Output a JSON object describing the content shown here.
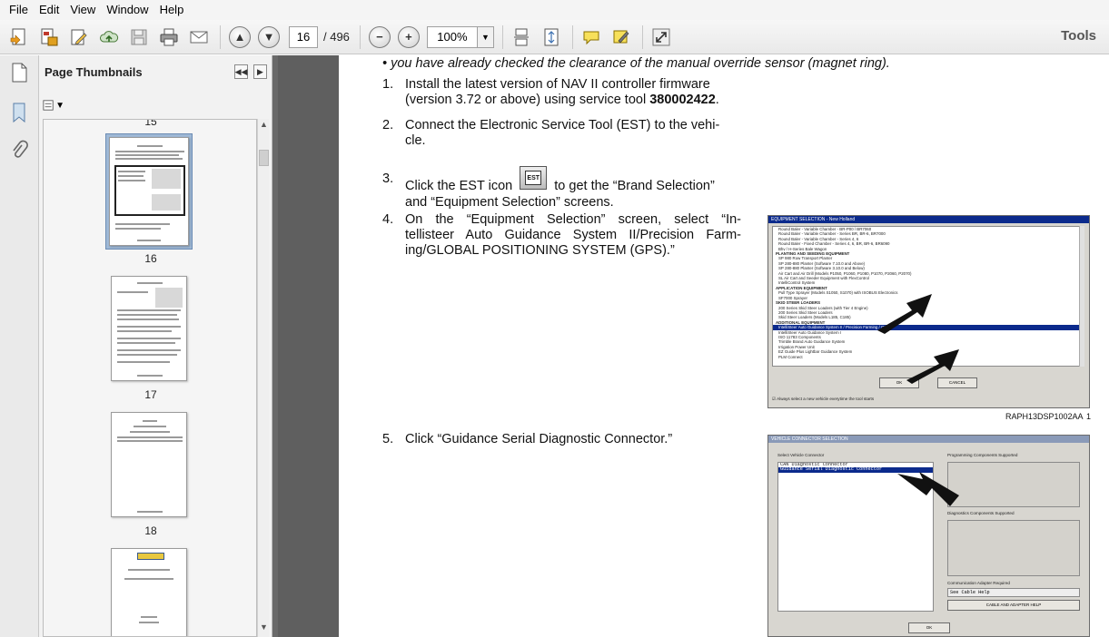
{
  "menu": [
    "File",
    "Edit",
    "View",
    "Window",
    "Help"
  ],
  "toolbar": {
    "page_current": "16",
    "page_total": "/ 496",
    "zoom": "100%",
    "tools_label": "Tools"
  },
  "thumbnails": {
    "title": "Page Thumbnails",
    "top_cut_label": "15",
    "pages": [
      {
        "num": "16",
        "selected": true
      },
      {
        "num": "17",
        "selected": false
      },
      {
        "num": "18",
        "selected": false
      }
    ]
  },
  "document": {
    "intro_line": "• you have already checked the clearance of the manual override sensor (magnet ring).",
    "steps": [
      {
        "n": "1.",
        "lines": [
          "Install the latest version of NAV II controller firmware",
          "(version 3.72 or above) using service tool "
        ],
        "bold": "380002422",
        "end": "."
      },
      {
        "n": "2.",
        "lines": [
          "Connect the Electronic Service Tool (EST) to the vehi-",
          "cle."
        ]
      },
      {
        "n": "3.",
        "pre": "Click the EST icon",
        "post": "to get the “Brand Selection”",
        "line2": "and “Equipment Selection” screens."
      },
      {
        "n": "4.",
        "lines": [
          "On the “Equipment Selection” screen, select “In-",
          "tellisteer Auto Guidance System II/Precision Farm-",
          "ing/GLOBAL POSITIONING SYSTEM (GPS).”"
        ]
      },
      {
        "n": "5.",
        "lines": [
          "Click “Guidance Serial Diagnostic Connector.”"
        ]
      }
    ],
    "est_icon_label": "EST",
    "figure1": {
      "title": "EQUIPMENT SELECTION - New Holland",
      "lines": [
        {
          "t": "Round Baler - Variable Chamber - BR-P00 / BR7060",
          "k": ""
        },
        {
          "t": "Round Baler - Variable Chamber - Series BR, BR-6, BR7000",
          "k": ""
        },
        {
          "t": "Round Baler - Variable Chamber - Series 4, 6",
          "k": ""
        },
        {
          "t": "Round Baler - Fixed Chamber - Series 4, 6, BR, BR-6, BR6090",
          "k": ""
        },
        {
          "t": "Bhv / H-Series Bale Wagon",
          "k": ""
        },
        {
          "t": "PLANTING AND SEEDING EQUIPMENT",
          "k": "head"
        },
        {
          "t": "SP 980 Row Transport Planter",
          "k": ""
        },
        {
          "t": "SP 280-880 Planter (Software 7.10.0 and Above)",
          "k": ""
        },
        {
          "t": "SP 280-880 Planter (Software 3.10.0 and Below)",
          "k": ""
        },
        {
          "t": "Air Cart and Air Drill (Models P1050, P1060, P1080, P1070, P2060, P2070)",
          "k": ""
        },
        {
          "t": "SL Air Cart and Seeder Equipment with FlexControl",
          "k": ""
        },
        {
          "t": "IntelliControl System",
          "k": ""
        },
        {
          "t": "APPLICATION EQUIPMENT",
          "k": "head"
        },
        {
          "t": "Pull Type Sprayer (Models S1050, S1070) with ISOBUS Electronics",
          "k": ""
        },
        {
          "t": "SF7000 Sprayer",
          "k": ""
        },
        {
          "t": "SKID STEER LOADERS",
          "k": "head"
        },
        {
          "t": "200 Series Skid Steer Loaders (with Tier 4 Engine)",
          "k": ""
        },
        {
          "t": "200 Series Skid Steer Loaders",
          "k": ""
        },
        {
          "t": "Skid Steer Loaders (Models L185, C185)",
          "k": ""
        },
        {
          "t": "ADDITIONAL EQUIPMENT",
          "k": "head"
        },
        {
          "t": "IntelliSteer Auto Guidance System II / Precision Farming / GPS",
          "k": "sel"
        },
        {
          "t": "IntelliSteer Auto Guidance System I",
          "k": ""
        },
        {
          "t": "ISO 11783 Components",
          "k": ""
        },
        {
          "t": "Trimble Brand Auto Guidance System",
          "k": ""
        },
        {
          "t": "Irrigation Power Unit",
          "k": ""
        },
        {
          "t": "EZ Guide Plus Lightbar Guidance System",
          "k": ""
        },
        {
          "t": "PLM Connect",
          "k": ""
        }
      ],
      "ok": "OK",
      "cancel": "CANCEL",
      "checkbox": "Always select a new vehicle everytime the tool starts"
    },
    "caption1": "RAPH13DSP1002AA",
    "caption1_num": "1",
    "figure2": {
      "title": "VEHICLE CONNECTOR SELECTION",
      "select_label": "Select Vehicle Connector",
      "items": [
        "CAN Diagnostic Connector",
        "Guidance Serial Diagnostic Connector"
      ],
      "prog_label": "Programming Components Supported",
      "diag_label": "Diagnostics Components Supported",
      "comm_label": "Communication Adapter Required",
      "comm_value": "See Cable Help",
      "cable_btn": "CABLE AND ADAPTER HELP",
      "ok": "OK"
    }
  }
}
